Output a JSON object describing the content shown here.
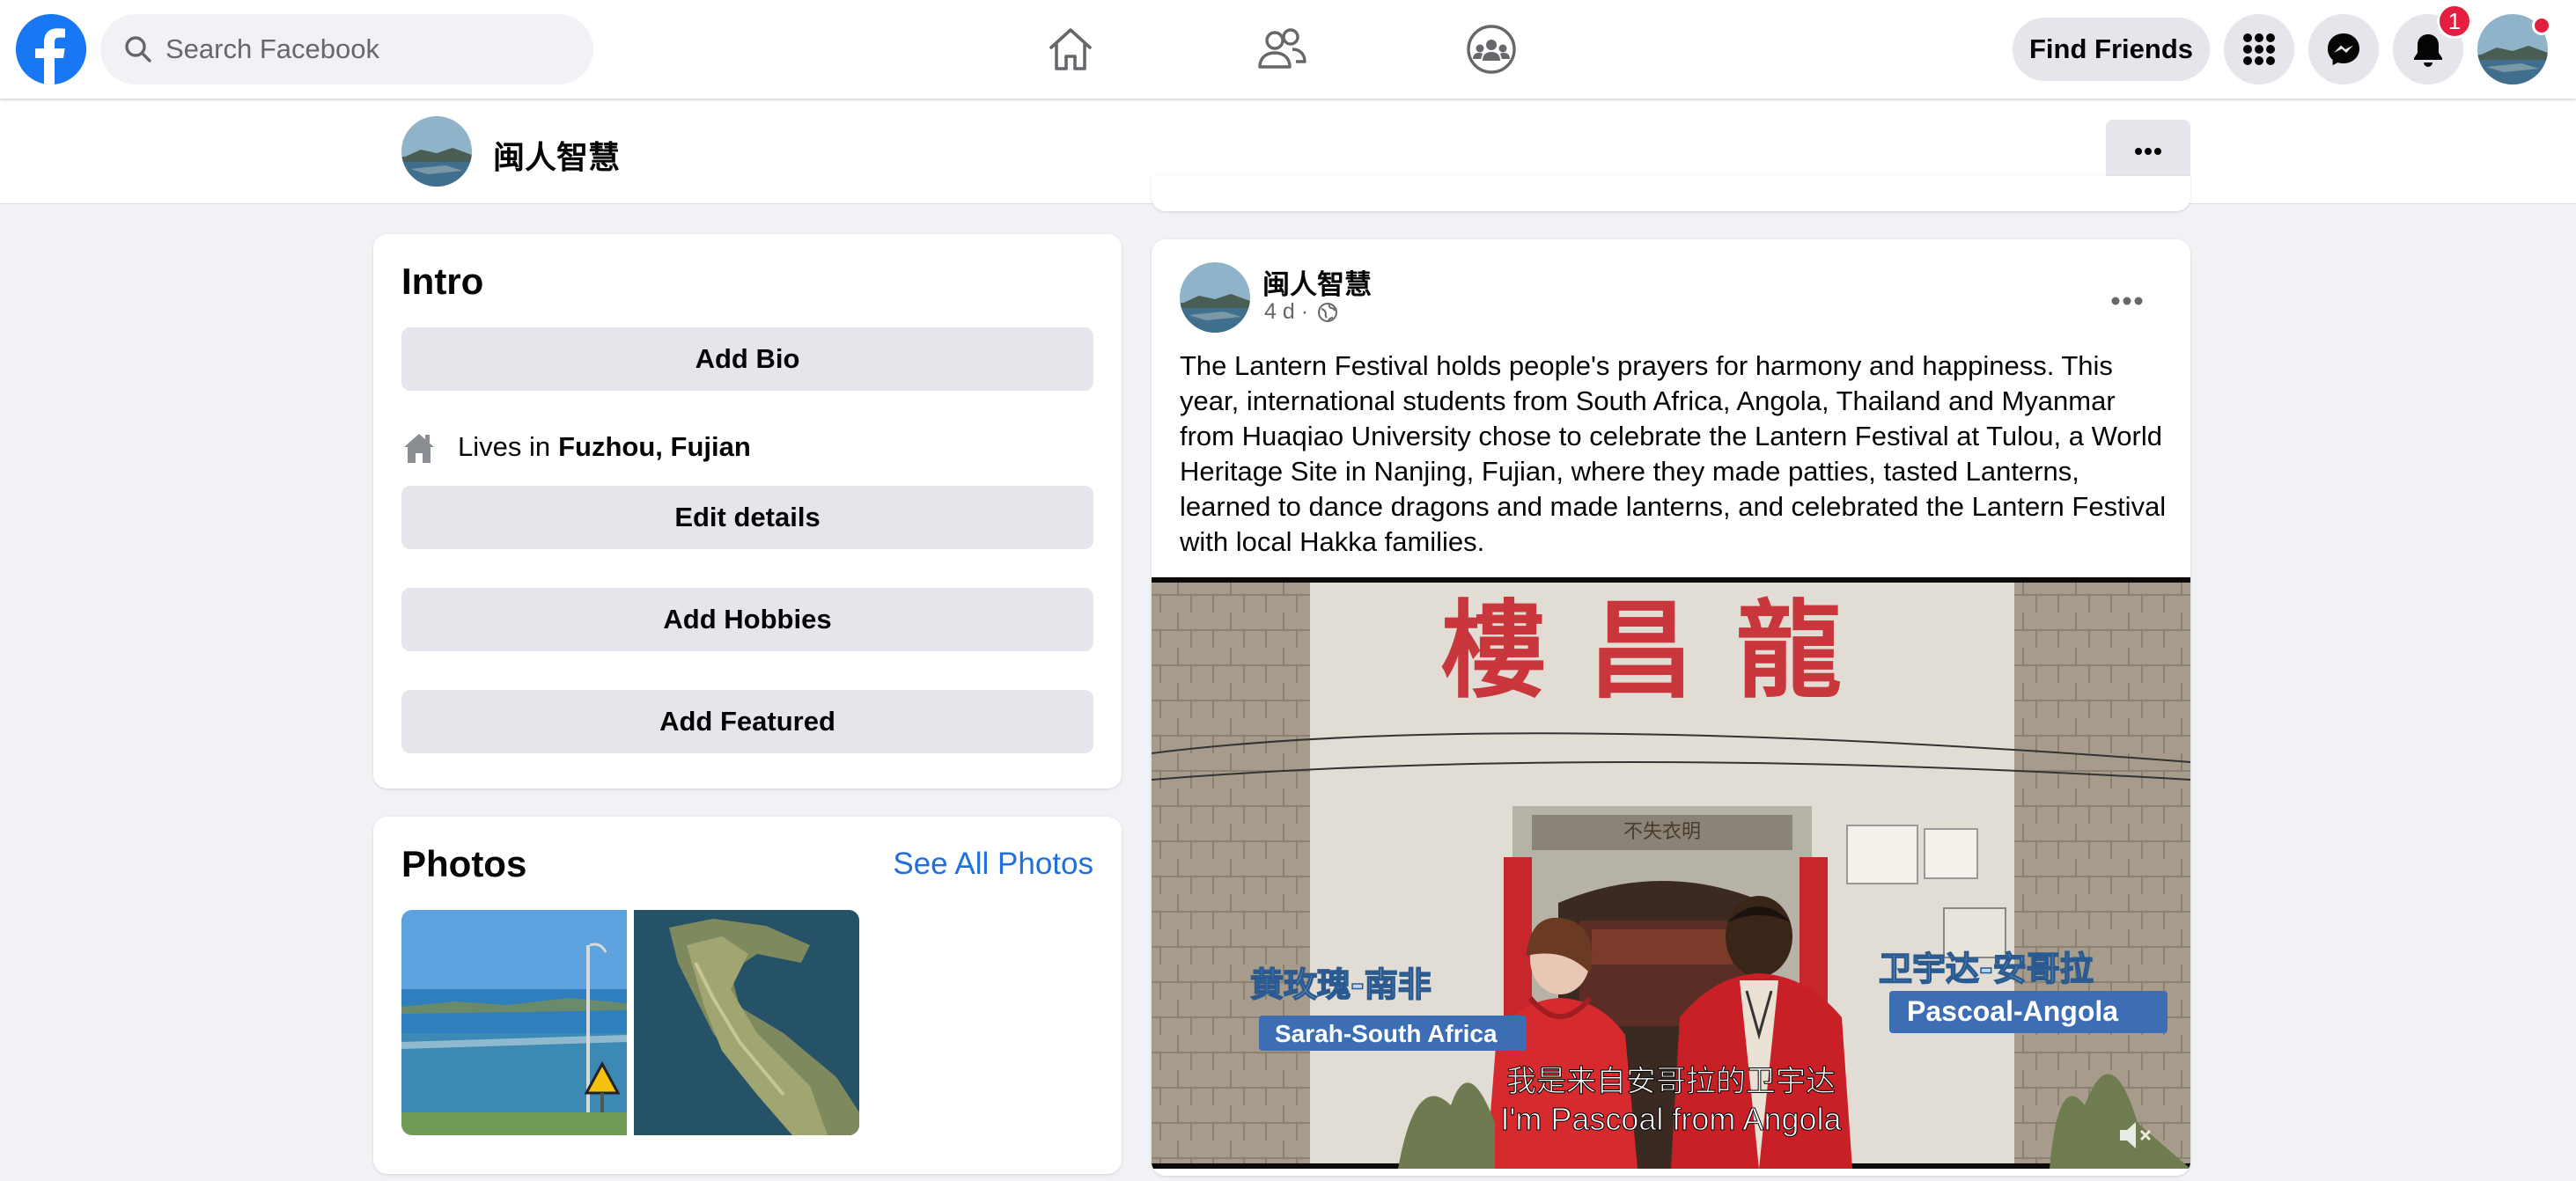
{
  "topbar": {
    "logo_icon": "facebook-logo-icon",
    "search_placeholder": "Search Facebook",
    "nav_icons": [
      "home-icon",
      "friends-icon",
      "groups-icon"
    ],
    "find_friends_label": "Find Friends",
    "menu_icon": "grid-menu-icon",
    "messenger_icon": "messenger-icon",
    "notifications_icon": "bell-icon",
    "notification_count": "1",
    "brand_color": "#1877f2",
    "badge_color": "#e41e3f"
  },
  "profile_header": {
    "name": "闽人智慧",
    "more_icon": "more-dots-icon"
  },
  "intro": {
    "title": "Intro",
    "add_bio_label": "Add Bio",
    "lives_in_prefix": "Lives in",
    "lives_in_place": "Fuzhou, Fujian",
    "edit_details_label": "Edit details",
    "add_hobbies_label": "Add Hobbies",
    "add_featured_label": "Add Featured"
  },
  "photos": {
    "title": "Photos",
    "see_all_label": "See All Photos",
    "link_color": "#216fdb"
  },
  "post": {
    "author": "闽人智慧",
    "time": "4 d ·",
    "privacy_icon": "globe-icon",
    "text": "The Lantern Festival holds people's prayers for harmony and happiness. This year, international students from South Africa, Angola, Thailand and Myanmar from Huaqiao University chose to celebrate the Lantern Festival at Tulou, a World Heritage Site in Nanjing, Fujian, where they made patties, tasted Lanterns, learned to dance dragons and made lanterns, and celebrated the Lantern Festival with local Hakka families.",
    "video": {
      "sign_text": "樓昌龍",
      "plaque_text": "不失衣明",
      "left_caption_cn": "黄玫瑰-南非",
      "left_caption_en": "Sarah-South Africa",
      "right_caption_cn": "卫宇达-安哥拉",
      "right_caption_en": "Pascoal-Angola",
      "subtitle_cn": "我是来自安哥拉的卫宇达",
      "subtitle_en": "I'm Pascoal from Angola",
      "mute_icon": "muted-speaker-icon"
    }
  }
}
